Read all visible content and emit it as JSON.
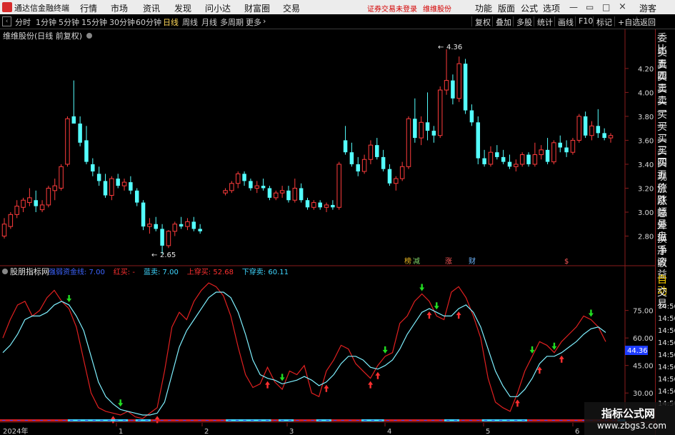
{
  "app": {
    "title": "通达信金融终端",
    "menu": [
      "行情",
      "市场",
      "资讯",
      "发现",
      "问小达",
      "财富圈",
      "交易"
    ],
    "warning": "证券交易未登录",
    "stock_tab": "维维股份",
    "right_menu": [
      "功能",
      "版面",
      "公式",
      "选项",
      "游客"
    ]
  },
  "periods": [
    "分时",
    "1分钟",
    "5分钟",
    "15分钟",
    "30分钟",
    "60分钟",
    "日线",
    "周线",
    "月线",
    "多周期",
    "更多"
  ],
  "active_period": "日线",
  "toolbar_right": [
    "复权",
    "叠加",
    "多股",
    "统计",
    "画线",
    "F10",
    "标记",
    "+自选",
    "返回"
  ],
  "main_chart": {
    "title": "维维股份(日线 前复权)",
    "price_axis": [
      "4.20",
      "4.00",
      "3.80",
      "3.60",
      "3.40",
      "3.20",
      "3.00",
      "2.80"
    ],
    "price_range": [
      2.63,
      4.42
    ],
    "high_label": "4.36",
    "low_label": "2.65",
    "event_tags": [
      "榜",
      "减",
      "涨",
      "财",
      "$"
    ]
  },
  "indicator": {
    "name": "股朋指标网",
    "params": [
      {
        "label": "强弱资金线",
        "value": "7.00",
        "color": "#3c64ff"
      },
      {
        "label": "红买",
        "value": "-",
        "color": "#ff3030"
      },
      {
        "label": "蓝卖",
        "value": "7.00",
        "color": "#3fd6ff"
      },
      {
        "label": "上穿买",
        "value": "52.68",
        "color": "#ff3030"
      },
      {
        "label": "下穿卖",
        "value": "60.11",
        "color": "#3fd6ff"
      }
    ],
    "axis": [
      "75.00",
      "60.00",
      "45.00",
      "30.00"
    ],
    "current_value": "44.36"
  },
  "date_axis": [
    "2024年",
    "1",
    "2",
    "3",
    "4",
    "5",
    "6"
  ],
  "right_panel": {
    "labels": [
      "委比",
      "卖五",
      "卖四",
      "卖三",
      "卖二",
      "卖一",
      "买一",
      "买二",
      "买三",
      "买四",
      "买五",
      "现价",
      "涨跌",
      "涨幅",
      "总量",
      "外盘",
      "换手",
      "净资",
      "收益"
    ],
    "auto_label": "自动",
    "trade_label": "交易",
    "times": [
      "14:56",
      "14:56",
      "14:56",
      "14:56",
      "14:56",
      "14:56",
      "14:56",
      "14:56",
      "14:56"
    ]
  },
  "watermark": {
    "title": "指标公式网",
    "url": "www.zbgs3.com"
  },
  "colors": {
    "up": "#ff3c3c",
    "down": "#54ffff",
    "fast_line": "#e02020",
    "slow_line": "#7ef0ff",
    "buy_arrow": "#ff3030",
    "sell_arrow": "#22dd22"
  },
  "chart_data": {
    "type": "candlestick",
    "candles_ohlc": [
      [
        2.8,
        2.95,
        2.78,
        2.9
      ],
      [
        2.88,
        3.0,
        2.86,
        2.98
      ],
      [
        2.98,
        3.1,
        2.95,
        3.05
      ],
      [
        3.04,
        3.12,
        3.0,
        3.1
      ],
      [
        3.08,
        3.2,
        3.05,
        3.12
      ],
      [
        3.1,
        3.18,
        3.0,
        3.05
      ],
      [
        3.02,
        3.1,
        3.0,
        3.06
      ],
      [
        3.06,
        3.22,
        3.04,
        3.2
      ],
      [
        3.18,
        3.28,
        3.1,
        3.22
      ],
      [
        3.2,
        3.4,
        3.18,
        3.38
      ],
      [
        3.4,
        3.8,
        3.38,
        3.78
      ],
      [
        3.8,
        4.1,
        3.75,
        3.74
      ],
      [
        3.74,
        3.8,
        3.55,
        3.58
      ],
      [
        3.6,
        3.72,
        3.4,
        3.42
      ],
      [
        3.4,
        3.45,
        3.3,
        3.34
      ],
      [
        3.32,
        3.38,
        3.22,
        3.26
      ],
      [
        3.26,
        3.32,
        3.12,
        3.14
      ],
      [
        3.14,
        3.3,
        3.1,
        3.28
      ],
      [
        3.28,
        3.32,
        3.2,
        3.22
      ],
      [
        3.22,
        3.28,
        3.18,
        3.25
      ],
      [
        3.25,
        3.3,
        3.15,
        3.18
      ],
      [
        3.18,
        3.2,
        3.05,
        3.08
      ],
      [
        3.08,
        3.1,
        2.85,
        2.88
      ],
      [
        2.88,
        2.95,
        2.82,
        2.9
      ],
      [
        2.9,
        2.96,
        2.84,
        2.86
      ],
      [
        2.86,
        2.9,
        2.65,
        2.72
      ],
      [
        2.72,
        2.85,
        2.7,
        2.84
      ],
      [
        2.84,
        2.92,
        2.8,
        2.9
      ],
      [
        2.9,
        2.96,
        2.86,
        2.88
      ],
      [
        2.88,
        2.95,
        2.85,
        2.92
      ],
      [
        2.92,
        2.96,
        2.84,
        2.86
      ],
      [
        2.86,
        2.9,
        2.82,
        2.84
      ],
      [
        3.16,
        3.2,
        3.14,
        3.18
      ],
      [
        3.18,
        3.26,
        3.16,
        3.24
      ],
      [
        3.24,
        3.34,
        3.2,
        3.32
      ],
      [
        3.32,
        3.34,
        3.22,
        3.26
      ],
      [
        3.26,
        3.28,
        3.18,
        3.2
      ],
      [
        3.2,
        3.26,
        3.16,
        3.22
      ],
      [
        3.22,
        3.28,
        3.18,
        3.2
      ],
      [
        3.2,
        3.22,
        3.1,
        3.12
      ],
      [
        3.12,
        3.18,
        3.1,
        3.16
      ],
      [
        3.16,
        3.22,
        3.12,
        3.18
      ],
      [
        3.18,
        3.22,
        3.08,
        3.1
      ],
      [
        3.1,
        3.28,
        3.08,
        3.2
      ],
      [
        3.2,
        3.24,
        3.08,
        3.1
      ],
      [
        3.1,
        3.12,
        3.02,
        3.04
      ],
      [
        3.04,
        3.1,
        3.02,
        3.08
      ],
      [
        3.08,
        3.1,
        3.02,
        3.04
      ],
      [
        3.04,
        3.08,
        3.0,
        3.06
      ],
      [
        3.06,
        3.1,
        3.02,
        3.04
      ],
      [
        3.04,
        3.42,
        3.02,
        3.4
      ],
      [
        3.6,
        3.72,
        3.48,
        3.5
      ],
      [
        3.5,
        3.58,
        3.38,
        3.4
      ],
      [
        3.4,
        3.46,
        3.3,
        3.34
      ],
      [
        3.34,
        3.48,
        3.32,
        3.44
      ],
      [
        3.44,
        3.6,
        3.4,
        3.56
      ],
      [
        3.56,
        3.62,
        3.44,
        3.46
      ],
      [
        3.46,
        3.52,
        3.34,
        3.36
      ],
      [
        3.36,
        3.4,
        3.22,
        3.24
      ],
      [
        3.24,
        3.3,
        3.18,
        3.28
      ],
      [
        3.28,
        3.42,
        3.26,
        3.38
      ],
      [
        3.38,
        3.8,
        3.36,
        3.78
      ],
      [
        3.78,
        3.95,
        3.58,
        3.62
      ],
      [
        3.62,
        3.8,
        3.56,
        3.75
      ],
      [
        3.75,
        4.0,
        3.6,
        3.68
      ],
      [
        3.68,
        3.72,
        3.58,
        3.64
      ],
      [
        3.64,
        4.05,
        3.62,
        4.02
      ],
      [
        4.02,
        4.36,
        3.98,
        4.1
      ],
      [
        4.1,
        4.15,
        3.9,
        3.95
      ],
      [
        3.95,
        4.3,
        3.92,
        4.24
      ],
      [
        4.24,
        4.28,
        3.82,
        3.85
      ],
      [
        3.85,
        3.9,
        3.72,
        3.75
      ],
      [
        3.75,
        3.8,
        3.4,
        3.45
      ],
      [
        3.45,
        3.52,
        3.38,
        3.4
      ],
      [
        3.4,
        3.55,
        3.38,
        3.5
      ],
      [
        3.5,
        3.56,
        3.44,
        3.46
      ],
      [
        3.46,
        3.52,
        3.4,
        3.42
      ],
      [
        3.42,
        3.48,
        3.36,
        3.38
      ],
      [
        3.38,
        3.44,
        3.34,
        3.4
      ],
      [
        3.4,
        3.5,
        3.38,
        3.48
      ],
      [
        3.48,
        3.5,
        3.38,
        3.4
      ],
      [
        3.4,
        3.58,
        3.38,
        3.48
      ],
      [
        3.48,
        3.56,
        3.44,
        3.52
      ],
      [
        3.52,
        3.62,
        3.4,
        3.42
      ],
      [
        3.42,
        3.6,
        3.4,
        3.58
      ],
      [
        3.58,
        3.64,
        3.5,
        3.54
      ],
      [
        3.54,
        3.6,
        3.46,
        3.5
      ],
      [
        3.5,
        3.62,
        3.48,
        3.6
      ],
      [
        3.6,
        3.82,
        3.58,
        3.8
      ],
      [
        3.8,
        3.84,
        3.62,
        3.64
      ],
      [
        3.64,
        3.76,
        3.6,
        3.72
      ],
      [
        3.72,
        3.86,
        3.62,
        3.66
      ],
      [
        3.66,
        3.7,
        3.6,
        3.62
      ],
      [
        3.62,
        3.66,
        3.58,
        3.64
      ]
    ],
    "gap_after_index": 31,
    "indicator_range": [
      18,
      92
    ],
    "fast_line": [
      60,
      70,
      78,
      80,
      72,
      75,
      82,
      86,
      80,
      76,
      66,
      48,
      30,
      22,
      20,
      19,
      18,
      20,
      17,
      16,
      19,
      22,
      42,
      66,
      74,
      70,
      80,
      86,
      90,
      88,
      83,
      72,
      55,
      40,
      33,
      35,
      44,
      36,
      32,
      42,
      40,
      45,
      30,
      28,
      42,
      48,
      56,
      54,
      46,
      42,
      38,
      45,
      50,
      52,
      68,
      72,
      80,
      84,
      80,
      72,
      70,
      85,
      88,
      82,
      72,
      60,
      38,
      25,
      22,
      20,
      30,
      42,
      50,
      58,
      56,
      52,
      58,
      62,
      66,
      72,
      70,
      66,
      58
    ],
    "slow_line": [
      52,
      56,
      62,
      70,
      72,
      72,
      74,
      78,
      80,
      78,
      72,
      64,
      50,
      36,
      28,
      24,
      21,
      20,
      19,
      18,
      18,
      19,
      25,
      40,
      55,
      64,
      70,
      76,
      82,
      85,
      85,
      82,
      74,
      62,
      48,
      40,
      38,
      37,
      35,
      36,
      37,
      39,
      37,
      34,
      36,
      40,
      46,
      50,
      50,
      48,
      44,
      43,
      45,
      48,
      54,
      62,
      68,
      74,
      76,
      74,
      72,
      72,
      76,
      78,
      74,
      66,
      54,
      42,
      34,
      28,
      28,
      32,
      38,
      46,
      50,
      50,
      52,
      55,
      58,
      62,
      65,
      66,
      63
    ],
    "buy_signals_idx": [
      15,
      21,
      36,
      44,
      50,
      51,
      58,
      62,
      70,
      73,
      76
    ],
    "sell_signals_idx": [
      9,
      16,
      38,
      52,
      57,
      59,
      72,
      75,
      80
    ]
  }
}
